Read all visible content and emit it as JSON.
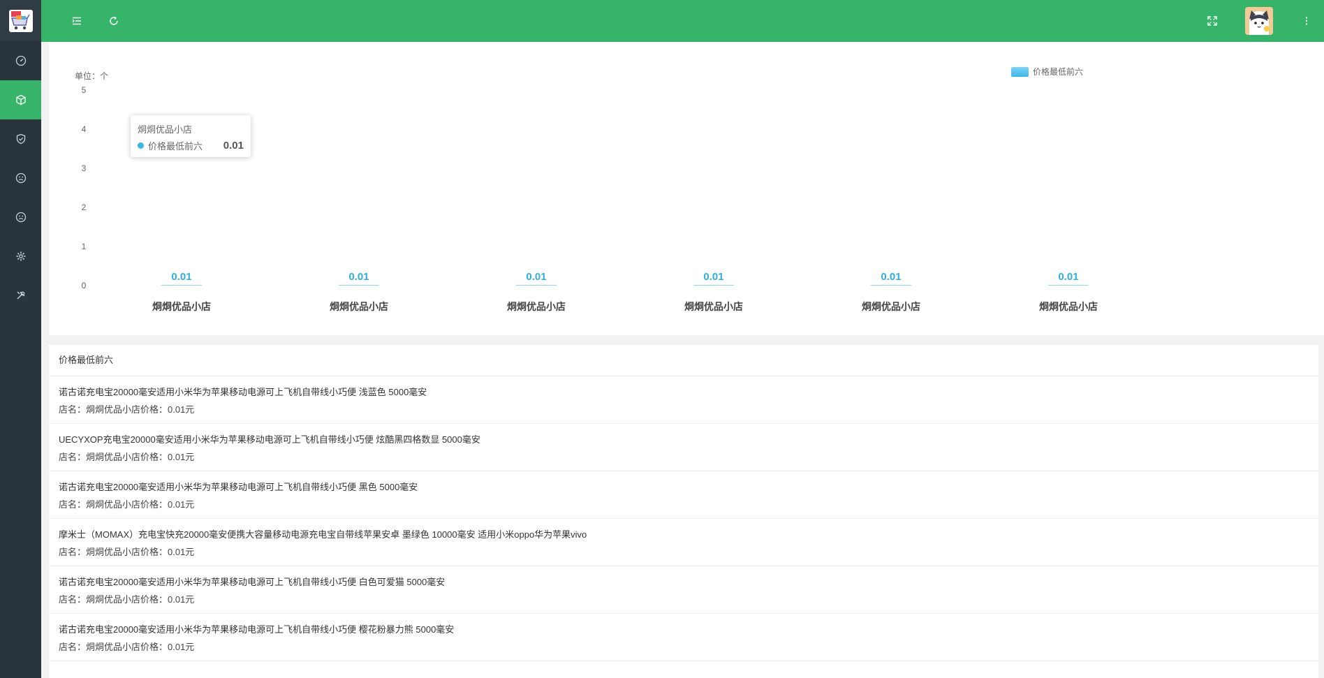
{
  "sidebar": {
    "items": [
      {
        "icon": "dashboard-icon",
        "active": false
      },
      {
        "icon": "cube-icon",
        "active": true
      },
      {
        "icon": "shield-check-icon",
        "active": false
      },
      {
        "icon": "sad-face-icon",
        "active": false
      },
      {
        "icon": "sad-face-icon",
        "active": false
      },
      {
        "icon": "gear-icon",
        "active": false
      },
      {
        "icon": "tools-icon",
        "active": false
      }
    ]
  },
  "colors": {
    "header": "#35b46a",
    "sidebar": "#2a343d",
    "bar": "#3cb6e8"
  },
  "chart": {
    "unit_label": "单位：个",
    "legend": "价格最低前六",
    "tooltip": {
      "title": "烔烔优品小店",
      "series": "价格最低前六",
      "value": "0.01"
    }
  },
  "chart_data": {
    "type": "bar",
    "categories": [
      "烔烔优品小店",
      "烔烔优品小店",
      "烔烔优品小店",
      "烔烔优品小店",
      "烔烔优品小店",
      "烔烔优品小店"
    ],
    "series": [
      {
        "name": "价格最低前六",
        "values": [
          0.01,
          0.01,
          0.01,
          0.01,
          0.01,
          0.01
        ]
      }
    ],
    "value_labels": [
      "0.01",
      "0.01",
      "0.01",
      "0.01",
      "0.01",
      "0.01"
    ],
    "ylabel": "单位：个",
    "ylim": [
      0,
      5
    ],
    "yticks": [
      "5",
      "4",
      "3",
      "2",
      "1",
      "0"
    ],
    "legend_position": "top-right",
    "grid": false
  },
  "list": {
    "title": "价格最低前六",
    "items": [
      {
        "name": "诺古诺充电宝20000毫安适用小米华为苹果移动电源可上飞机自带线小巧便 浅蓝色 5000毫安",
        "meta": "店名：烔烔优品小店价格：0.01元"
      },
      {
        "name": "UECYXOP充电宝20000毫安适用小米华为苹果移动电源可上飞机自带线小巧便 炫酷黑四格数显 5000毫安",
        "meta": "店名：烔烔优品小店价格：0.01元"
      },
      {
        "name": "诺古诺充电宝20000毫安适用小米华为苹果移动电源可上飞机自带线小巧便 黑色 5000毫安",
        "meta": "店名：烔烔优品小店价格：0.01元"
      },
      {
        "name": "摩米士（MOMAX）充电宝快充20000毫安便携大容量移动电源充电宝自带线苹果安卓 墨绿色 10000毫安 适用小米oppo华为苹果vivo",
        "meta": "店名：烔烔优品小店价格：0.01元"
      },
      {
        "name": "诺古诺充电宝20000毫安适用小米华为苹果移动电源可上飞机自带线小巧便 白色可爱猫 5000毫安",
        "meta": "店名：烔烔优品小店价格：0.01元"
      },
      {
        "name": "诺古诺充电宝20000毫安适用小米华为苹果移动电源可上飞机自带线小巧便 樱花粉暴力熊 5000毫安",
        "meta": "店名：烔烔优品小店价格：0.01元"
      }
    ]
  }
}
